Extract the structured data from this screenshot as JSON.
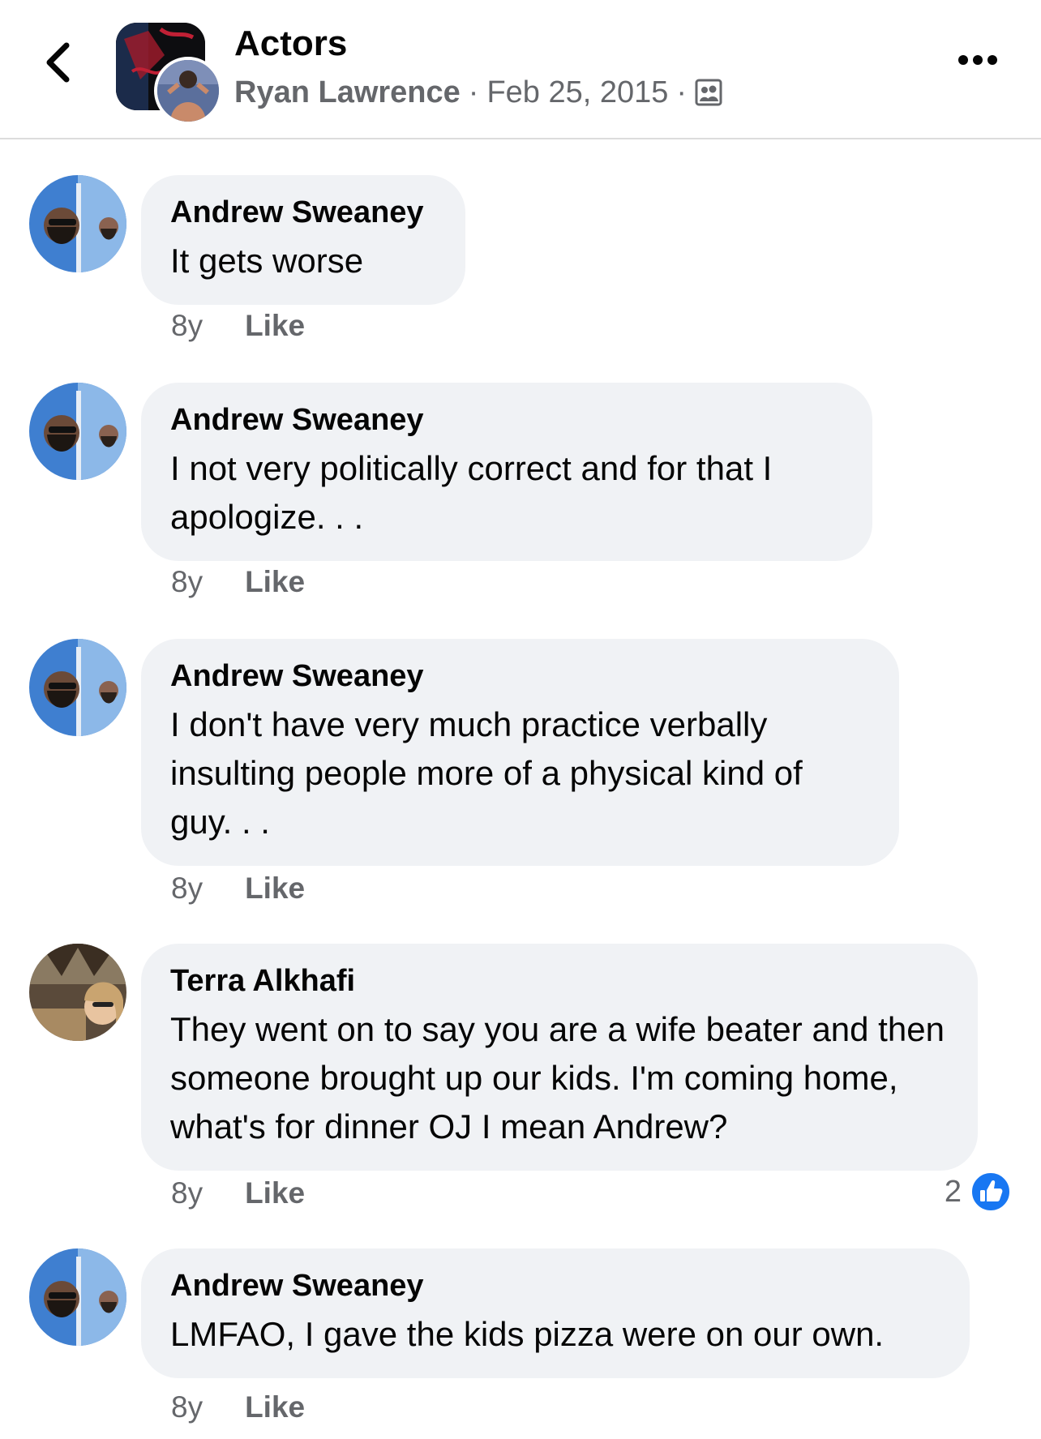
{
  "header": {
    "group_name": "Actors",
    "author": "Ryan Lawrence",
    "separator": "·",
    "date": "Feb 25, 2015",
    "privacy_icon": "group-members-icon",
    "back_icon": "chevron-left-icon",
    "more_icon": "more-dots-icon"
  },
  "comments": [
    {
      "name": "Andrew Sweaney",
      "text": "It gets worse",
      "time": "8y",
      "like_label": "Like"
    },
    {
      "name": "Andrew Sweaney",
      "text": "I not very politically correct and for that I apologize. . .",
      "time": "8y",
      "like_label": "Like"
    },
    {
      "name": "Andrew Sweaney",
      "text": "I don't have very much practice verbally insulting people more of a physical kind of guy. . .",
      "time": "8y",
      "like_label": "Like"
    },
    {
      "name": "Terra Alkhafi",
      "text": "They went on to say you are a wife beater and then someone brought up our kids. I'm coming home, what's for dinner OJ I mean Andrew?",
      "time": "8y",
      "like_label": "Like",
      "reaction_count": "2",
      "reaction_icon": "thumbs-up-icon"
    },
    {
      "name": "Andrew Sweaney",
      "text": "LMFAO, I gave the kids pizza were on our own.",
      "time": "8y",
      "like_label": "Like"
    }
  ],
  "colors": {
    "bubble": "#f0f2f5",
    "secondary_text": "#65676b",
    "like_blue": "#1877f2"
  }
}
